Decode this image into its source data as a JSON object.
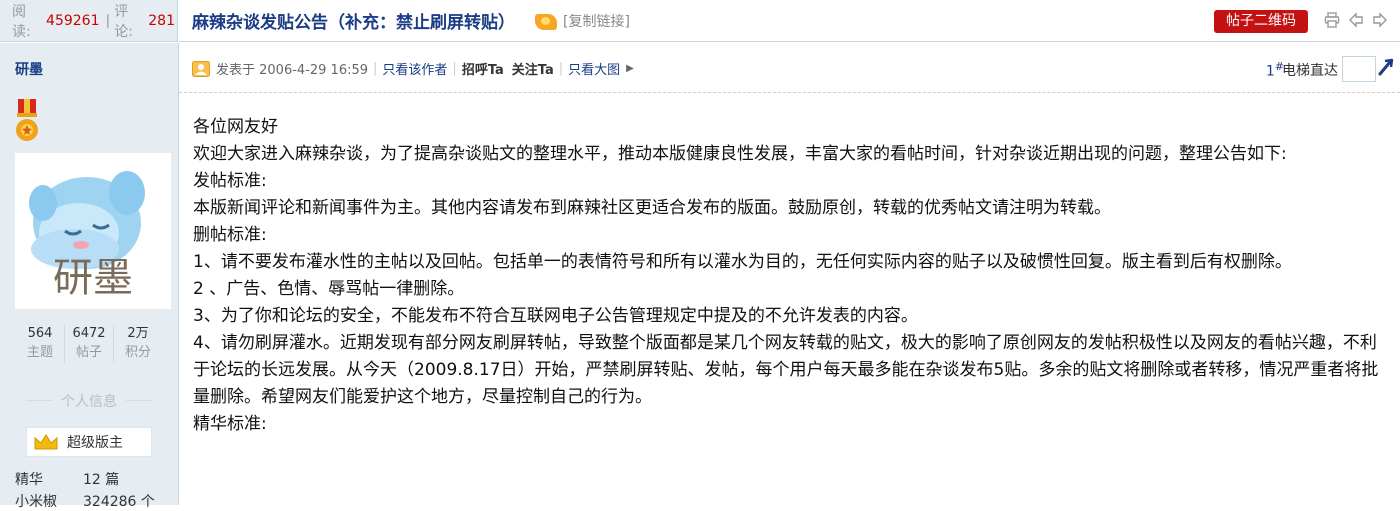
{
  "stats_bar": {
    "views_label": "阅读:",
    "views": "459261",
    "sep": "|",
    "replies_label": "评论:",
    "replies": "281"
  },
  "thread": {
    "title": "麻辣杂谈发贴公告（补充：禁止刷屏转贴）",
    "copy_link": "[复制链接]",
    "qr_button": "帖子二维码",
    "icons": [
      "fire-icon",
      "print-icon",
      "prev-icon",
      "next-icon"
    ]
  },
  "user": {
    "name": "研墨",
    "avatar_text": "研墨",
    "stats": [
      {
        "value": "564",
        "label": "主题"
      },
      {
        "value": "6472",
        "label": "帖子"
      },
      {
        "value": "2万",
        "label": "积分"
      }
    ],
    "section_title": "个人信息",
    "rank": "超级版主",
    "info": [
      {
        "key": "精华",
        "value": "12 篇"
      },
      {
        "key": "小米椒",
        "value": "324286 个"
      }
    ]
  },
  "post_meta": {
    "posted_at": "发表于 2006-4-29 16:59",
    "only_author": "只看该作者",
    "greet": "招呼Ta",
    "follow": "关注Ta",
    "large_image": "只看大图",
    "floor": "1",
    "floor_mark": "#",
    "elevator_label": "电梯直达",
    "elevator_value": ""
  },
  "post": {
    "paragraphs": [
      "各位网友好",
      "欢迎大家进入麻辣杂谈，为了提高杂谈贴文的整理水平，推动本版健康良性发展，丰富大家的看帖时间，针对杂谈近期出现的问题，整理公告如下:",
      "发帖标准:",
      "本版新闻评论和新闻事件为主。其他内容请发布到麻辣社区更适合发布的版面。鼓励原创，转载的优秀帖文请注明为转载。",
      "删帖标准:",
      "1、请不要发布灌水性的主帖以及回帖。包括单一的表情符号和所有以灌水为目的，无任何实际内容的贴子以及破惯性回复。版主看到后有权删除。",
      "2 、广告、色情、辱骂帖一律删除。",
      "3、为了你和论坛的安全，不能发布不符合互联网电子公告管理规定中提及的不允许发表的内容。",
      "4、请勿刷屏灌水。近期发现有部分网友刷屏转帖，导致整个版面都是某几个网友转载的贴文，极大的影响了原创网友的发帖积极性以及网友的看帖兴趣，不利于论坛的长远发展。从今天（2009.8.17日）开始，严禁刷屏转贴、发帖，每个用户每天最多能在杂谈发布5贴。多余的贴文将删除或者转移，情况严重者将批量删除。希望网友们能爱护这个地方，尽量控制自己的行为。",
      "精华标准:"
    ]
  },
  "colors": {
    "sidebar_bg": "#e5edf2",
    "link": "#1b3d85",
    "accent_red": "#c41212",
    "count_red": "#cc0000"
  }
}
